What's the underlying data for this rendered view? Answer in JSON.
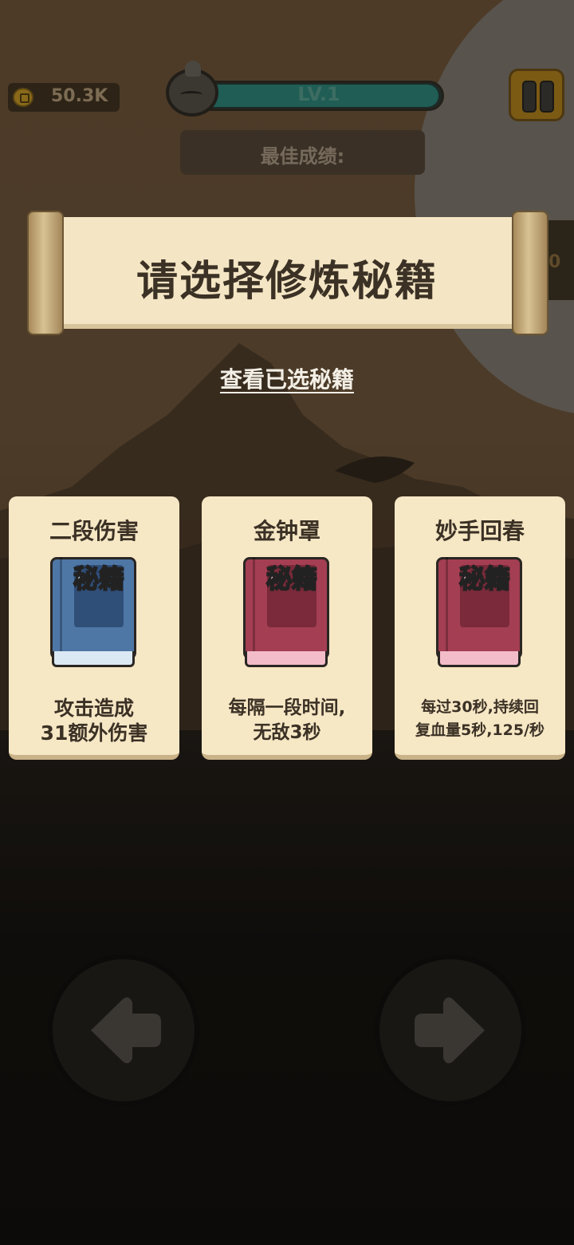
{
  "hud": {
    "coins": "50.3K",
    "level": "LV.1",
    "best_score_label": "最佳成绩:",
    "side_tab_text": "0"
  },
  "banner": {
    "title": "请选择修炼秘籍",
    "view_selected_link": "查看已选秘籍"
  },
  "cards": [
    {
      "title": "二段伤害",
      "book_color": "#4f77a6",
      "book_text": "秘籍",
      "description": "攻击造成\n31额外伤害"
    },
    {
      "title": "金钟罩",
      "book_color": "#a43e53",
      "book_text": "秘籍",
      "description": "每隔一段时间,\n无敌3秒"
    },
    {
      "title": "妙手回春",
      "book_color": "#a43e53",
      "book_text": "秘籍",
      "description": "每过30秒,持续回\n复血量5秒,125/秒"
    }
  ],
  "controls": {
    "left_icon": "arrow-left-icon",
    "right_icon": "arrow-right-icon"
  }
}
